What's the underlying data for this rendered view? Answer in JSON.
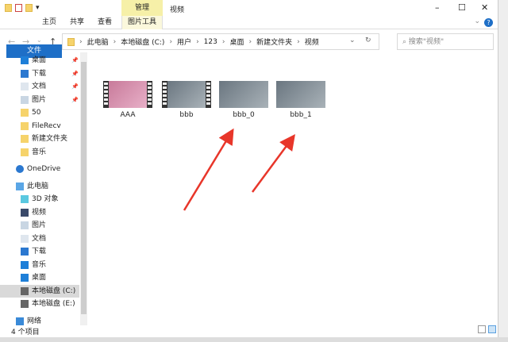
{
  "window": {
    "title": "视频",
    "context_tab": "管理",
    "minimize": "–",
    "maximize": "☐",
    "close": "✕"
  },
  "ribbon": {
    "tabs": [
      "文件",
      "主页",
      "共享",
      "查看",
      "图片工具"
    ],
    "help": "?",
    "collapse": "⌄"
  },
  "address": {
    "segments": [
      "此电脑",
      "本地磁盘 (C:)",
      "用户",
      "123",
      "桌面",
      "新建文件夹",
      "视频"
    ],
    "separator": "›",
    "dropdown": "⌄",
    "refresh": "↻",
    "search_placeholder": "搜索\"视频\"",
    "back": "←",
    "forward": "→",
    "recent": "⌄",
    "up": "↑"
  },
  "nav": {
    "quick": [
      {
        "label": "桌面",
        "icon": "desktop-icon",
        "pinned": true
      },
      {
        "label": "下载",
        "icon": "download-icon",
        "pinned": true
      },
      {
        "label": "文档",
        "icon": "document-icon",
        "pinned": true
      },
      {
        "label": "图片",
        "icon": "pictures-icon",
        "pinned": true
      },
      {
        "label": "50",
        "icon": "folder-icon"
      },
      {
        "label": "FileRecv",
        "icon": "folder-icon"
      },
      {
        "label": "新建文件夹",
        "icon": "folder-icon"
      },
      {
        "label": "音乐",
        "icon": "folder-icon"
      }
    ],
    "onedrive": "OneDrive",
    "thispc": "此电脑",
    "pc": [
      {
        "label": "3D 对象",
        "icon": "3d-objects-icon"
      },
      {
        "label": "视频",
        "icon": "videos-icon"
      },
      {
        "label": "图片",
        "icon": "pictures-icon"
      },
      {
        "label": "文档",
        "icon": "document-icon"
      },
      {
        "label": "下载",
        "icon": "download-icon"
      },
      {
        "label": "音乐",
        "icon": "music-icon"
      },
      {
        "label": "桌面",
        "icon": "desktop-icon"
      },
      {
        "label": "本地磁盘 (C:)",
        "icon": "drive-icon",
        "selected": true
      },
      {
        "label": "本地磁盘 (E:)",
        "icon": "drive-icon"
      }
    ],
    "network": "网络"
  },
  "files": [
    {
      "name": "AAA",
      "style": "film",
      "colors": [
        "#c87a9a",
        "#e8b0c8"
      ]
    },
    {
      "name": "bbb",
      "style": "film",
      "colors": [
        "#6a7680",
        "#a9b2b8"
      ]
    },
    {
      "name": "bbb_0",
      "style": "plain",
      "colors": [
        "#6a7680",
        "#a9b2b8"
      ]
    },
    {
      "name": "bbb_1",
      "style": "plain",
      "colors": [
        "#6a7680",
        "#a9b2b8"
      ]
    }
  ],
  "status": {
    "count": "4 个项目"
  },
  "colors": {
    "accent": "#1e6fc7",
    "arrow": "#e8362a"
  }
}
